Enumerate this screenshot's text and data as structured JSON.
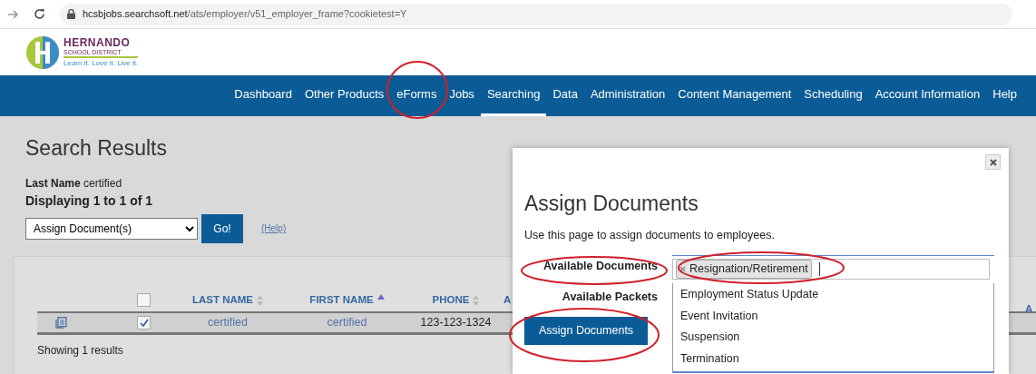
{
  "browser": {
    "url_host": "hcsbjobs.searchsoft.net",
    "url_path": "/ats/employer/v51_employer_frame?cookietest=Y"
  },
  "logo": {
    "name_line": "HERNANDO",
    "sub_line": "SCHOOL DISTRICT",
    "tagline": "Learn it. Love it. Live it."
  },
  "nav": [
    {
      "label": "Dashboard",
      "selected": false
    },
    {
      "label": "Other Products",
      "selected": false
    },
    {
      "label": "eForms",
      "selected": false
    },
    {
      "label": "Jobs",
      "selected": false
    },
    {
      "label": "Searching",
      "selected": true
    },
    {
      "label": "Data",
      "selected": false
    },
    {
      "label": "Administration",
      "selected": false
    },
    {
      "label": "Content Management",
      "selected": false
    },
    {
      "label": "Scheduling",
      "selected": false
    },
    {
      "label": "Account Information",
      "selected": false
    },
    {
      "label": "Help",
      "selected": false
    }
  ],
  "page": {
    "title": "Search Results",
    "filter_label": "Last Name",
    "filter_value": "certified",
    "displaying": "Displaying 1 to 1 of 1",
    "action_select": "Assign Document(s)",
    "go_button": "Go!",
    "help_link": "(Help)"
  },
  "table": {
    "select_all_checked": false,
    "columns": [
      {
        "label": "LAST NAME",
        "sorted_ascending": false
      },
      {
        "label": "FIRST NAME",
        "sorted_ascending": true
      },
      {
        "label": "PHONE",
        "sorted_ascending": false
      },
      {
        "label": "A"
      }
    ],
    "rows": [
      {
        "checked": true,
        "last_name": "certified",
        "first_name": "certified",
        "phone": "123-123-1324"
      }
    ],
    "footer": "Showing 1 results",
    "right_column": "A"
  },
  "modal": {
    "title": "Assign Documents",
    "description": "Use this page to assign documents to employees.",
    "documents_label": "Available Documents",
    "packets_label": "Available Packets",
    "selected_tags": [
      "Resignation/Retirement"
    ],
    "options": [
      "Employment Status Update",
      "Event Invitation",
      "Suspension",
      "Termination"
    ],
    "submit": "Assign Documents"
  }
}
